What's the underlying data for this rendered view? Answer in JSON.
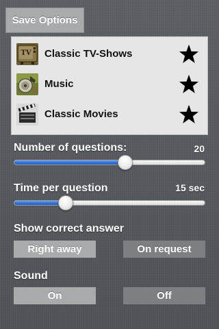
{
  "header": {
    "save_label": "Save Options"
  },
  "categories": [
    {
      "label": "Classic TV-Shows",
      "icon": "tv-icon",
      "icon_text": "TV",
      "favorite_icon": "star-icon"
    },
    {
      "label": "Music",
      "icon": "music-icon",
      "favorite_icon": "star-icon"
    },
    {
      "label": "Classic Movies",
      "icon": "clapperboard-icon",
      "favorite_icon": "star-icon"
    }
  ],
  "questions": {
    "label": "Number of questions:",
    "value": "20",
    "slider_fraction": 0.59
  },
  "time": {
    "label": "Time per question",
    "value": "15 sec",
    "slider_fraction": 0.25
  },
  "show_answer": {
    "label": "Show correct answer",
    "options": [
      "Right away",
      "On request"
    ],
    "selected": "Right away"
  },
  "sound": {
    "label": "Sound",
    "options": [
      "On",
      "Off"
    ],
    "selected": "On"
  },
  "colors": {
    "background": "#55595d",
    "panel": "#e6e6e6",
    "selected_button": "#a9aaac",
    "unselected_button": "#7d8083",
    "slider_fill": "#2f6fd6"
  }
}
